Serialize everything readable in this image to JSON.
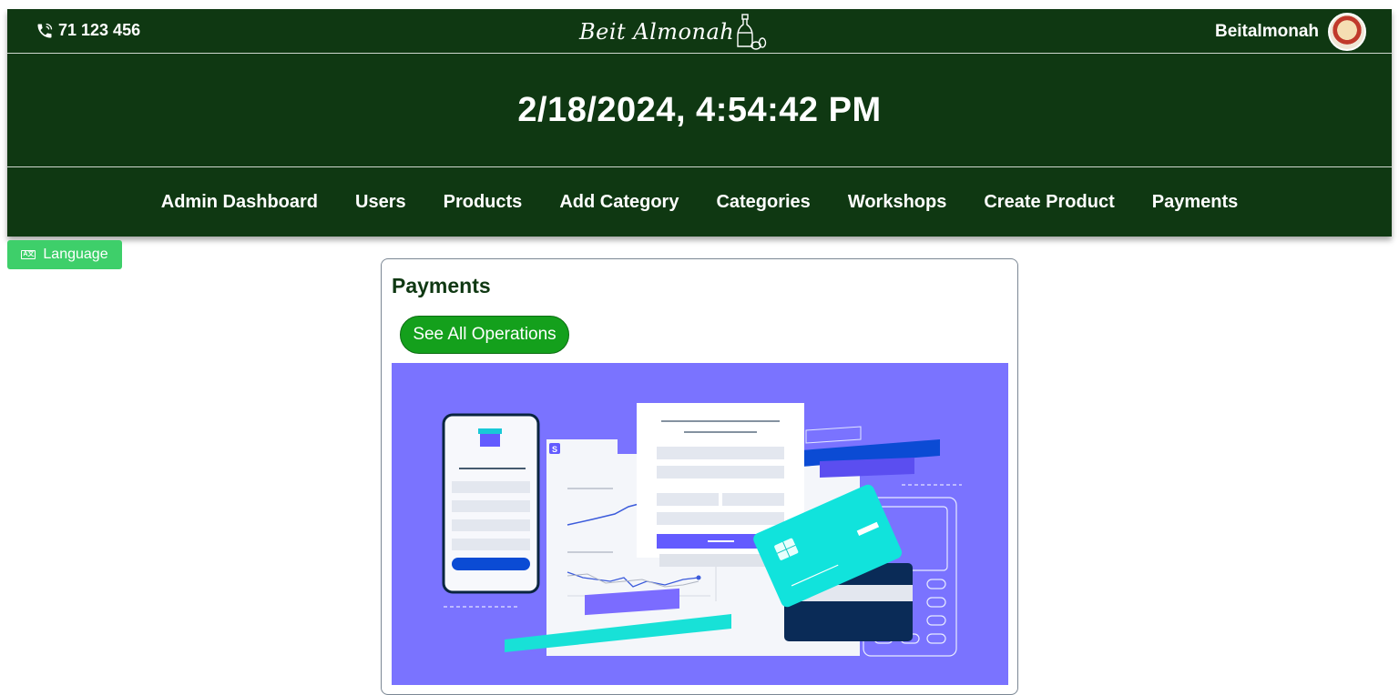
{
  "header": {
    "phone": "71 123 456",
    "logo_text": "Beit Almonah",
    "username": "Beitalmonah"
  },
  "clock": {
    "datetime": "2/18/2024, 4:54:42 PM"
  },
  "nav": {
    "items": [
      {
        "label": "Admin Dashboard"
      },
      {
        "label": "Users"
      },
      {
        "label": "Products"
      },
      {
        "label": "Add Category"
      },
      {
        "label": "Categories"
      },
      {
        "label": "Workshops"
      },
      {
        "label": "Create Product"
      },
      {
        "label": "Payments"
      }
    ]
  },
  "language_button": {
    "label": "Language",
    "icon": "translate-icon"
  },
  "payments_card": {
    "title": "Payments",
    "button_label": "See All Operations",
    "illustration_icon": "payment-illustration"
  },
  "colors": {
    "header_bg": "#0f3812",
    "language_bg": "#3ecf6a",
    "button_bg": "#14a01c",
    "illustration_bg": "#7a73ff"
  }
}
